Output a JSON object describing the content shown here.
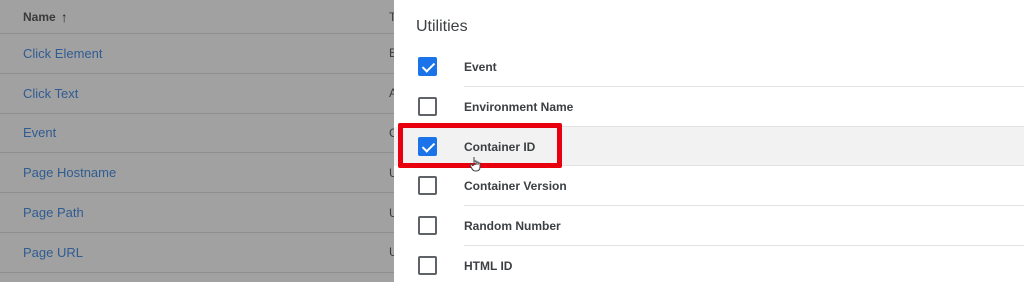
{
  "table": {
    "header": {
      "name_label": "Name",
      "sort_icon": "arrow-up-icon",
      "col2_label": "T"
    },
    "rows": [
      {
        "name": "Click Element",
        "type": "E"
      },
      {
        "name": "Click Text",
        "type": "A"
      },
      {
        "name": "Event",
        "type": "C"
      },
      {
        "name": "Page Hostname",
        "type": "U"
      },
      {
        "name": "Page Path",
        "type": "U"
      },
      {
        "name": "Page URL",
        "type": "U"
      }
    ]
  },
  "panel": {
    "section_title": "Utilities",
    "options": [
      {
        "label": "Event",
        "checked": true
      },
      {
        "label": "Environment Name",
        "checked": false
      },
      {
        "label": "Container ID",
        "checked": true
      },
      {
        "label": "Container Version",
        "checked": false
      },
      {
        "label": "Random Number",
        "checked": false
      },
      {
        "label": "HTML ID",
        "checked": false
      }
    ]
  },
  "colors": {
    "accent": "#1a73e8",
    "highlight": "#e8000f",
    "link": "#2f5c92"
  }
}
